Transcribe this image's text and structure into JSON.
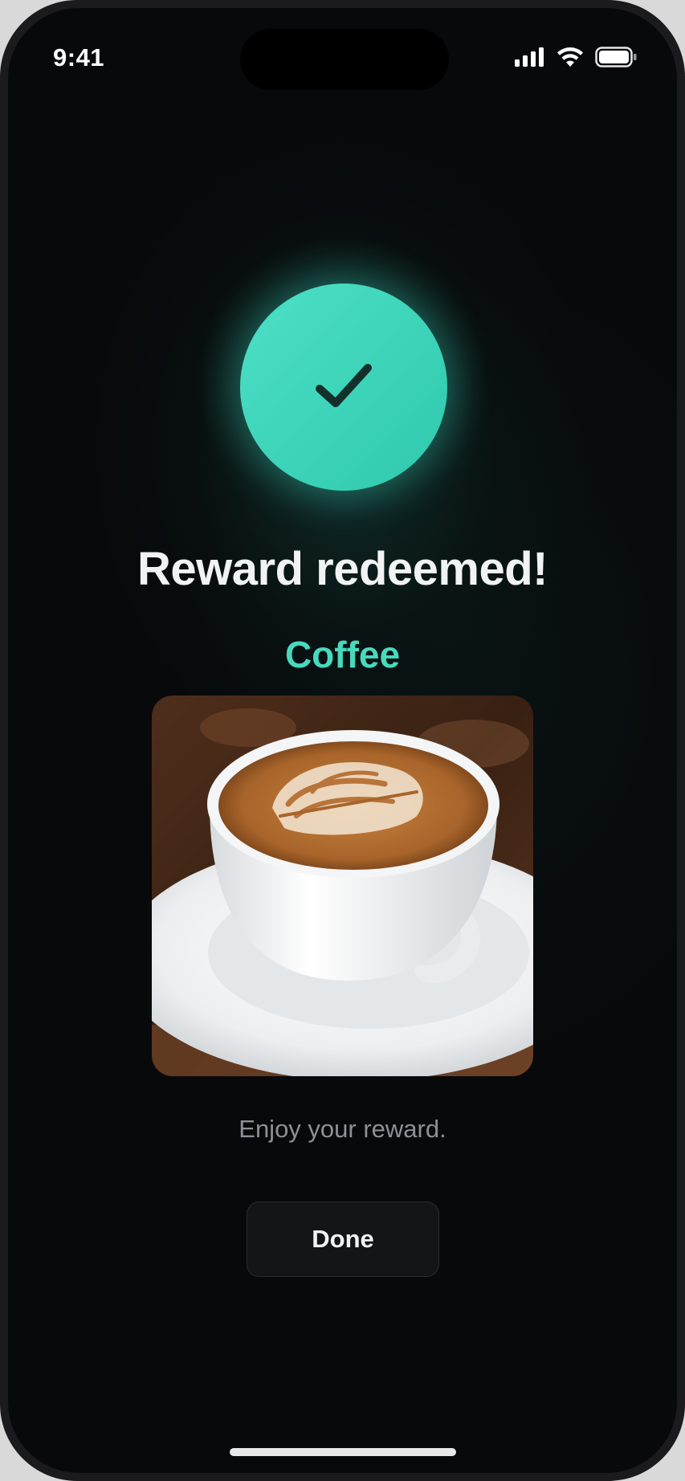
{
  "status_bar": {
    "time": "9:41",
    "icons": [
      "cellular-signal-icon",
      "wifi-icon",
      "battery-icon"
    ]
  },
  "success": {
    "icon": "checkmark-icon",
    "title": "Reward redeemed!",
    "reward_name": "Coffee",
    "image": "latte-art-coffee-cup",
    "message": "Enjoy your reward."
  },
  "actions": {
    "done_label": "Done"
  },
  "colors": {
    "accent": "#48d9bd",
    "background": "#08090b",
    "title": "#f1f2f3",
    "caption": "#8d9096"
  }
}
